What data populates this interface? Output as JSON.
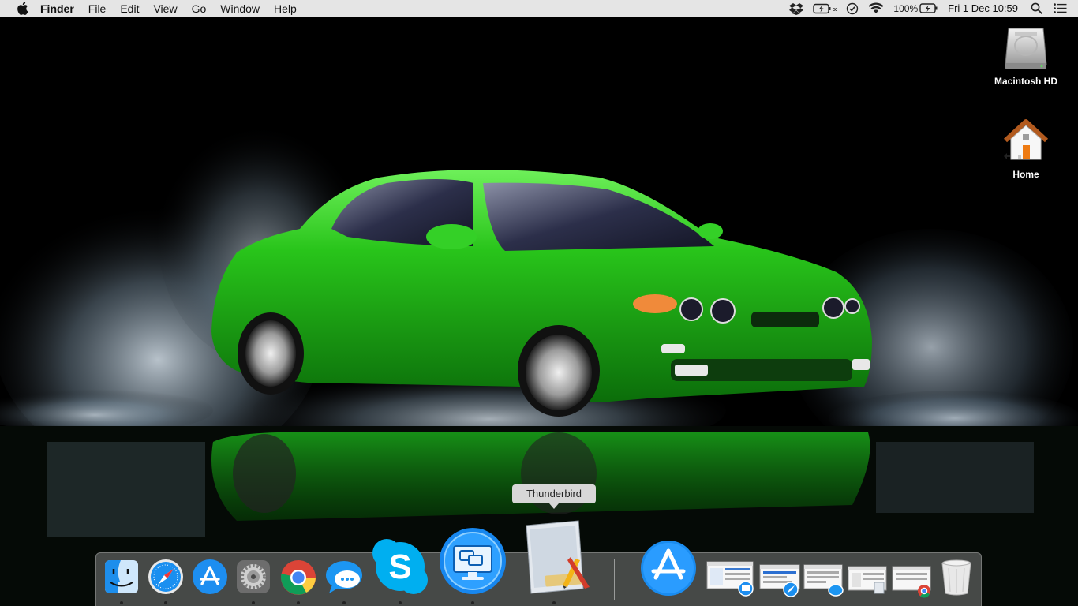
{
  "menubar": {
    "app_name": "Finder",
    "menus": [
      "File",
      "Edit",
      "View",
      "Go",
      "Window",
      "Help"
    ],
    "battery": "100%",
    "datetime": "Fri 1 Dec  10:59"
  },
  "desktop": {
    "icons": [
      {
        "label": "Macintosh HD",
        "icon": "hard-drive-icon"
      },
      {
        "label": "Home",
        "icon": "home-folder-icon"
      }
    ]
  },
  "tooltip": "Thunderbird",
  "dock": {
    "apps": [
      {
        "name": "Finder",
        "icon": "finder-icon",
        "running": true
      },
      {
        "name": "Safari",
        "icon": "safari-icon",
        "running": true
      },
      {
        "name": "App Store",
        "icon": "app-store-icon",
        "running": false
      },
      {
        "name": "System Preferences",
        "icon": "system-preferences-icon",
        "running": true
      },
      {
        "name": "Google Chrome",
        "icon": "chrome-icon",
        "running": true
      },
      {
        "name": "Messages",
        "icon": "messages-icon",
        "running": true
      },
      {
        "name": "Skype",
        "icon": "skype-icon",
        "running": true
      },
      {
        "name": "Screen Sharing",
        "icon": "screen-sharing-icon",
        "running": true
      },
      {
        "name": "Thunderbird",
        "icon": "thunderbird-installer-icon",
        "running": true
      }
    ],
    "right": [
      {
        "name": "App Store",
        "icon": "app-store-icon"
      },
      {
        "name": "Minimized window",
        "icon": "minimized-window-icon"
      },
      {
        "name": "Minimized window",
        "icon": "minimized-window-icon"
      },
      {
        "name": "Minimized window",
        "icon": "minimized-window-icon"
      },
      {
        "name": "Minimized window",
        "icon": "minimized-window-icon"
      },
      {
        "name": "Minimized window",
        "icon": "minimized-window-icon"
      },
      {
        "name": "Trash",
        "icon": "trash-icon"
      }
    ]
  },
  "colors": {
    "car_green": "#27c41d",
    "menubar_bg": "#eeeeee",
    "tooltip_bg": "#d7d7d7"
  }
}
